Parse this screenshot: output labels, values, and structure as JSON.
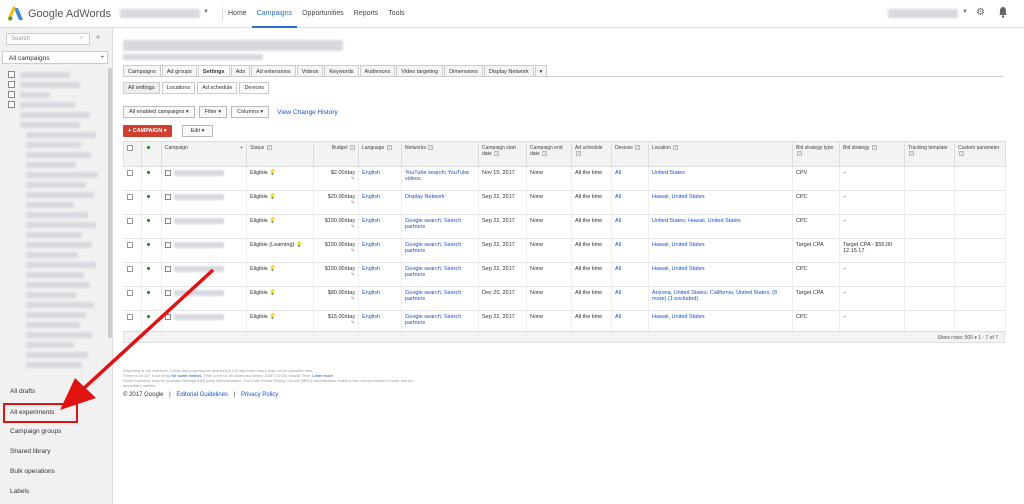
{
  "brand": "Google AdWords",
  "nav": [
    "Home",
    "Campaigns",
    "Opportunities",
    "Reports",
    "Tools"
  ],
  "nav_active": "Campaigns",
  "sidebar": {
    "search_placeholder": "Search",
    "all_campaigns": "All campaigns",
    "links": [
      "All drafts",
      "All experiments",
      "Campaign groups",
      "Shared library",
      "Bulk operations",
      "Labels"
    ]
  },
  "tabs": [
    "Campaigns",
    "Ad groups",
    "Settings",
    "Ads",
    "Ad extensions",
    "Videos",
    "Keywords",
    "Audiences",
    "Video targeting",
    "Dimensions",
    "Display Network"
  ],
  "tab_active": "Settings",
  "tab_more": "▾",
  "subtabs": [
    "All settings",
    "Locations",
    "Ad schedule",
    "Devices"
  ],
  "filters": {
    "enabled": "All enabled campaigns ▾",
    "filter": "Filter ▾",
    "columns": "Columns ▾",
    "history": "View Change History"
  },
  "actions": {
    "add": "+ CAMPAIGN ▾",
    "edit": "Edit ▾"
  },
  "table": {
    "headers": [
      "Campaign",
      "Status",
      "Budget",
      "Language",
      "Networks",
      "Campaign start date",
      "Campaign end date",
      "Ad schedule",
      "Devices",
      "Location",
      "Bid strategy type",
      "Bid strategy",
      "Tracking template",
      "Custom parameter"
    ],
    "rows": [
      {
        "status": "Eligible",
        "budget": "$2.00/day",
        "language": "English",
        "networks": "YouTube search; YouTube videos",
        "start": "Nov 15, 2017",
        "end": "None",
        "schedule": "All the time",
        "devices": "All",
        "location": "United States",
        "bid_type": "CPV",
        "bid": "--"
      },
      {
        "status": "Eligible",
        "budget": "$20.00/day",
        "language": "English",
        "networks": "Display Network",
        "start": "Sep 22, 2017",
        "end": "None",
        "schedule": "All the time",
        "devices": "All",
        "location": "Hawaii, United States",
        "bid_type": "CPC",
        "bid": "--"
      },
      {
        "status": "Eligible",
        "budget": "$100.00/day",
        "language": "English",
        "networks": "Google search; Search partners",
        "start": "Sep 22, 2017",
        "end": "None",
        "schedule": "All the time",
        "devices": "All",
        "location": "United States; Hawaii, United States",
        "bid_type": "CPC",
        "bid": "--"
      },
      {
        "status": "Eligible (Learning)",
        "budget": "$100.00/day",
        "language": "English",
        "networks": "Google search; Search partners",
        "start": "Sep 22, 2017",
        "end": "None",
        "schedule": "All the time",
        "devices": "All",
        "location": "Hawaii, United States",
        "bid_type": "Target CPA",
        "bid": "Target CPA - $55.00 12.15.17"
      },
      {
        "status": "Eligible",
        "budget": "$100.00/day",
        "language": "English",
        "networks": "Google search; Search partners",
        "start": "Sep 22, 2017",
        "end": "None",
        "schedule": "All the time",
        "devices": "All",
        "location": "Hawaii, United States",
        "bid_type": "CPC",
        "bid": "--"
      },
      {
        "status": "Eligible",
        "budget": "$80.00/day",
        "language": "English",
        "networks": "Google search; Search partners",
        "start": "Dec 20, 2017",
        "end": "None",
        "schedule": "All the time",
        "devices": "All",
        "location": "Arizona, United States; California, United States; (8 more) (1 excluded)",
        "bid_type": "Target CPA",
        "bid": "--"
      },
      {
        "status": "Eligible",
        "budget": "$15.00/day",
        "language": "English",
        "networks": "Google search; Search partners",
        "start": "Sep 22, 2017",
        "end": "None",
        "schedule": "All the time",
        "devices": "All",
        "location": "Hawaii, United States",
        "bid_type": "CPC",
        "bid": "--"
      }
    ],
    "footer": "Show rows: 500 ▾   1 - 7 of 7"
  },
  "disclaimer": {
    "line1": "Reporting is not real-time. Clicks and impressions received in the last three hours may not be included here.",
    "line2a": "There is an 18+ hour delay",
    "line2b": "for some metrics.",
    "line2c": "Time zone for all dates and times: (GMT-10:00) Hawaii Time.",
    "line2d": "Learn more",
    "line3": "Some inventory may be provided through third party intermediaries. You'll see Media Rating Council (MRC) accreditation noted in the column header's hover text for accredited metrics."
  },
  "footer": {
    "copyright": "© 2017 Google",
    "guidelines": "Editorial Guidelines",
    "privacy": "Privacy Policy",
    "sep": "|"
  },
  "colors": {
    "accent": "#2b6fcb",
    "add_button": "#d23f31",
    "highlight": "#e01212",
    "eligible_dot": "#0a8f08"
  }
}
